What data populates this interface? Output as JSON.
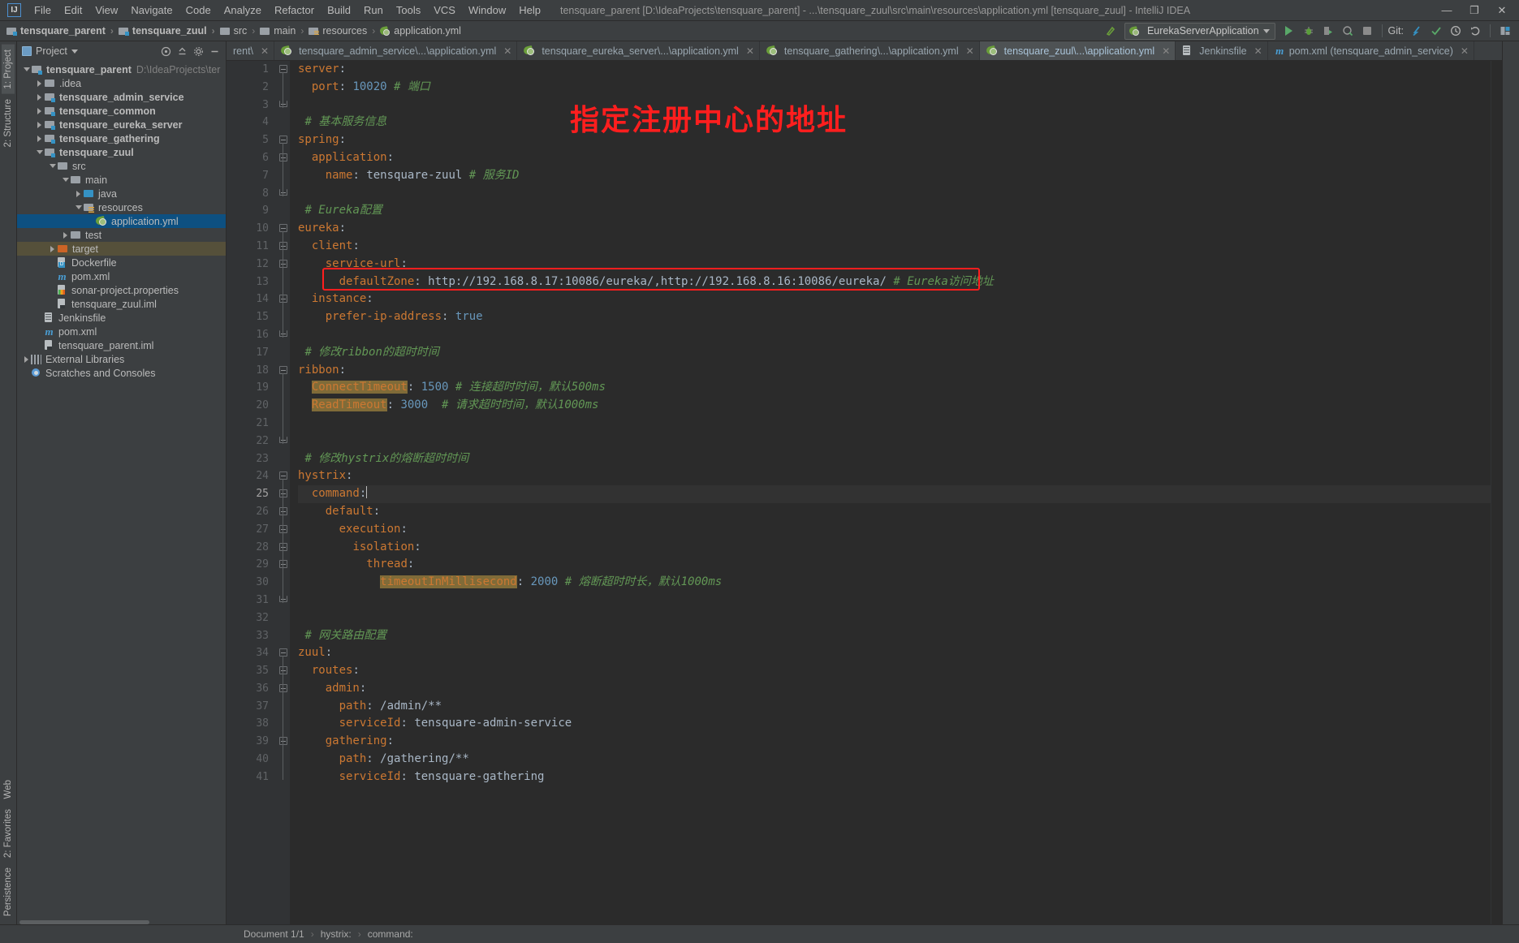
{
  "window": {
    "title": "tensquare_parent [D:\\IdeaProjects\\tensquare_parent] - ...\\tensquare_zuul\\src\\main\\resources\\application.yml [tensquare_zuul] - IntelliJ IDEA",
    "logo": "IJ",
    "minimize": "—",
    "maximize": "❐",
    "close": "✕"
  },
  "menu": [
    {
      "label": "File"
    },
    {
      "label": "Edit"
    },
    {
      "label": "View"
    },
    {
      "label": "Navigate"
    },
    {
      "label": "Code"
    },
    {
      "label": "Analyze"
    },
    {
      "label": "Refactor"
    },
    {
      "label": "Build"
    },
    {
      "label": "Run"
    },
    {
      "label": "Tools"
    },
    {
      "label": "VCS"
    },
    {
      "label": "Window"
    },
    {
      "label": "Help"
    }
  ],
  "breadcrumbs": [
    {
      "label": "tensquare_parent",
      "icon": "module-icon"
    },
    {
      "label": "tensquare_zuul",
      "icon": "module-icon"
    },
    {
      "label": "src",
      "icon": "folder-icon"
    },
    {
      "label": "main",
      "icon": "folder-icon"
    },
    {
      "label": "resources",
      "icon": "resources-folder-icon"
    },
    {
      "label": "application.yml",
      "icon": "yaml-file-icon"
    }
  ],
  "toolbar": {
    "run_configuration": "EurekaServerApplication",
    "git_label": "Git:",
    "icons": [
      "build-icon",
      "run-icon",
      "debug-icon",
      "run-coverage-icon",
      "profile-icon",
      "stop-icon",
      "update-project-icon",
      "commit-icon",
      "history-icon",
      "rollback-icon",
      "settings-icon"
    ]
  },
  "project_panel": {
    "title": "Project",
    "tools": [
      "collapse-all-icon",
      "scroll-from-source-icon",
      "settings-icon",
      "hide-icon"
    ],
    "tree": [
      {
        "depth": 0,
        "arrow": "down",
        "icon": "module-icon",
        "label": "tensquare_parent",
        "bold": true,
        "path": "D:\\IdeaProjects\\ter"
      },
      {
        "depth": 1,
        "arrow": "right",
        "icon": "folder-icon",
        "label": ".idea",
        "bold": false,
        "path": ""
      },
      {
        "depth": 1,
        "arrow": "right",
        "icon": "module-icon",
        "label": "tensquare_admin_service",
        "bold": true,
        "path": ""
      },
      {
        "depth": 1,
        "arrow": "right",
        "icon": "module-icon",
        "label": "tensquare_common",
        "bold": true,
        "path": ""
      },
      {
        "depth": 1,
        "arrow": "right",
        "icon": "module-icon",
        "label": "tensquare_eureka_server",
        "bold": true,
        "path": ""
      },
      {
        "depth": 1,
        "arrow": "right",
        "icon": "module-icon",
        "label": "tensquare_gathering",
        "bold": true,
        "path": ""
      },
      {
        "depth": 1,
        "arrow": "down",
        "icon": "module-icon",
        "label": "tensquare_zuul",
        "bold": true,
        "path": ""
      },
      {
        "depth": 2,
        "arrow": "down",
        "icon": "folder-icon",
        "label": "src",
        "bold": false,
        "path": ""
      },
      {
        "depth": 3,
        "arrow": "down",
        "icon": "folder-icon",
        "label": "main",
        "bold": false,
        "path": ""
      },
      {
        "depth": 4,
        "arrow": "right",
        "icon": "source-root-icon",
        "label": "java",
        "bold": false,
        "path": ""
      },
      {
        "depth": 4,
        "arrow": "down",
        "icon": "resources-folder-icon",
        "label": "resources",
        "bold": false,
        "path": ""
      },
      {
        "depth": 5,
        "arrow": "none",
        "icon": "yaml-file-icon",
        "label": "application.yml",
        "bold": false,
        "path": "",
        "selected": true
      },
      {
        "depth": 3,
        "arrow": "right",
        "icon": "folder-icon",
        "label": "test",
        "bold": false,
        "path": ""
      },
      {
        "depth": 2,
        "arrow": "right",
        "icon": "target-folder-icon",
        "label": "target",
        "bold": false,
        "path": "",
        "target": true
      },
      {
        "depth": 2,
        "arrow": "none",
        "icon": "dockerfile-icon",
        "label": "Dockerfile",
        "bold": false,
        "path": ""
      },
      {
        "depth": 2,
        "arrow": "none",
        "icon": "maven-pom-icon",
        "label": "pom.xml",
        "bold": false,
        "path": ""
      },
      {
        "depth": 2,
        "arrow": "none",
        "icon": "sonar-properties-icon",
        "label": "sonar-project.properties",
        "bold": false,
        "path": ""
      },
      {
        "depth": 2,
        "arrow": "none",
        "icon": "iml-file-icon",
        "label": "tensquare_zuul.iml",
        "bold": false,
        "path": ""
      },
      {
        "depth": 1,
        "arrow": "none",
        "icon": "jenkins-file-icon",
        "label": "Jenkinsfile",
        "bold": false,
        "path": ""
      },
      {
        "depth": 1,
        "arrow": "none",
        "icon": "maven-pom-icon",
        "label": "pom.xml",
        "bold": false,
        "path": ""
      },
      {
        "depth": 1,
        "arrow": "none",
        "icon": "iml-file-icon",
        "label": "tensquare_parent.iml",
        "bold": false,
        "path": ""
      },
      {
        "depth": 0,
        "arrow": "right",
        "icon": "library-icon",
        "label": "External Libraries",
        "bold": false,
        "path": ""
      },
      {
        "depth": 0,
        "arrow": "none",
        "icon": "scratches-icon",
        "label": "Scratches and Consoles",
        "bold": false,
        "path": ""
      }
    ]
  },
  "left_tool_strip": {
    "top": [
      "1: Project",
      "2: Structure"
    ],
    "bottom": [
      "Web",
      "2: Favorites",
      "Persistence"
    ]
  },
  "editor_tabs": [
    {
      "label": "rent\\",
      "icon": "file-icon",
      "active": false
    },
    {
      "label": "tensquare_admin_service\\...\\application.yml",
      "icon": "yaml-file-icon",
      "active": false
    },
    {
      "label": "tensquare_eureka_server\\...\\application.yml",
      "icon": "yaml-file-icon",
      "active": false
    },
    {
      "label": "tensquare_gathering\\...\\application.yml",
      "icon": "yaml-file-icon",
      "active": false
    },
    {
      "label": "tensquare_zuul\\...\\application.yml",
      "icon": "yaml-file-icon",
      "active": true
    },
    {
      "label": "Jenkinsfile",
      "icon": "jenkins-file-icon",
      "active": false
    },
    {
      "label": "pom.xml (tensquare_admin_service)",
      "icon": "maven-pom-icon",
      "active": false
    }
  ],
  "editor": {
    "current_line": 25,
    "total_lines": 41,
    "lines": [
      {
        "n": 1,
        "fold": "start",
        "html": "<span class=\"k\">server</span><span class=\"kk\">:</span>"
      },
      {
        "n": 2,
        "fold": "none",
        "html": "  <span class=\"k\">port</span><span class=\"kk\">:</span> <span class=\"num\">10020</span> <span class=\"cmt\"># 端口</span>"
      },
      {
        "n": 3,
        "fold": "end",
        "html": ""
      },
      {
        "n": 4,
        "fold": "none",
        "html": " <span class=\"cmt\"># 基本服务信息</span>"
      },
      {
        "n": 5,
        "fold": "start",
        "html": "<span class=\"k\">spring</span><span class=\"kk\">:</span>"
      },
      {
        "n": 6,
        "fold": "start",
        "html": "  <span class=\"k\">application</span><span class=\"kk\">:</span>"
      },
      {
        "n": 7,
        "fold": "none",
        "html": "    <span class=\"k\">name</span><span class=\"kk\">:</span> <span class=\"val\">tensquare-zuul</span> <span class=\"cmt\"># 服务ID</span>"
      },
      {
        "n": 8,
        "fold": "end",
        "html": ""
      },
      {
        "n": 9,
        "fold": "none",
        "html": " <span class=\"cmt\"># Eureka配置</span>"
      },
      {
        "n": 10,
        "fold": "start",
        "html": "<span class=\"k\">eureka</span><span class=\"kk\">:</span>"
      },
      {
        "n": 11,
        "fold": "start",
        "html": "  <span class=\"k\">client</span><span class=\"kk\">:</span>"
      },
      {
        "n": 12,
        "fold": "start",
        "html": "    <span class=\"k\">service-url</span><span class=\"kk\">:</span>"
      },
      {
        "n": 13,
        "fold": "none",
        "html": "      <span class=\"k\">defaultZone</span><span class=\"kk\">:</span> <span class=\"val\">http://192.168.8.17:10086/eureka/,http://192.168.8.16:10086/eureka/</span> <span class=\"cmt\"># Eureka访问地址</span>"
      },
      {
        "n": 14,
        "fold": "start",
        "html": "  <span class=\"k\">instance</span><span class=\"kk\">:</span>"
      },
      {
        "n": 15,
        "fold": "none",
        "html": "    <span class=\"k\">prefer-ip-address</span><span class=\"kk\">:</span> <span class=\"num\">true</span>"
      },
      {
        "n": 16,
        "fold": "end",
        "html": ""
      },
      {
        "n": 17,
        "fold": "none",
        "html": " <span class=\"cmt\"># 修改ribbon的超时时间</span>"
      },
      {
        "n": 18,
        "fold": "start",
        "html": "<span class=\"k\">ribbon</span><span class=\"kk\">:</span>"
      },
      {
        "n": 19,
        "fold": "none",
        "html": "  <span class=\"hl\">ConnectTimeout</span><span class=\"kk\">:</span> <span class=\"num\">1500</span> <span class=\"cmt\"># 连接超时时间，默认500ms</span>"
      },
      {
        "n": 20,
        "fold": "none",
        "html": "  <span class=\"hl\">ReadTimeout</span><span class=\"kk\">:</span> <span class=\"num\">3000</span>  <span class=\"cmt\"># 请求超时时间，默认1000ms</span>"
      },
      {
        "n": 21,
        "fold": "none",
        "html": ""
      },
      {
        "n": 22,
        "fold": "end",
        "html": ""
      },
      {
        "n": 23,
        "fold": "none",
        "html": " <span class=\"cmt\"># 修改hystrix的熔断超时时间</span>"
      },
      {
        "n": 24,
        "fold": "start",
        "html": "<span class=\"k\">hystrix</span><span class=\"kk\">:</span>"
      },
      {
        "n": 25,
        "fold": "start",
        "html": "  <span class=\"k\">command</span><span class=\"kk\">:</span><span class=\"caret\"></span>",
        "current": true
      },
      {
        "n": 26,
        "fold": "start",
        "html": "    <span class=\"k\">default</span><span class=\"kk\">:</span>"
      },
      {
        "n": 27,
        "fold": "start",
        "html": "      <span class=\"k\">execution</span><span class=\"kk\">:</span>"
      },
      {
        "n": 28,
        "fold": "start",
        "html": "        <span class=\"k\">isolation</span><span class=\"kk\">:</span>"
      },
      {
        "n": 29,
        "fold": "start",
        "html": "          <span class=\"k\">thread</span><span class=\"kk\">:</span>"
      },
      {
        "n": 30,
        "fold": "none",
        "html": "            <span class=\"hl\">timeoutInMillisecond</span><span class=\"kk\">:</span> <span class=\"num\">2000</span> <span class=\"cmt\"># 熔断超时时长，默认1000ms</span>"
      },
      {
        "n": 31,
        "fold": "end",
        "html": ""
      },
      {
        "n": 32,
        "fold": "none",
        "html": ""
      },
      {
        "n": 33,
        "fold": "none",
        "html": " <span class=\"cmt\"># 网关路由配置</span>"
      },
      {
        "n": 34,
        "fold": "start",
        "html": "<span class=\"k\">zuul</span><span class=\"kk\">:</span>"
      },
      {
        "n": 35,
        "fold": "start",
        "html": "  <span class=\"k\">routes</span><span class=\"kk\">:</span>"
      },
      {
        "n": 36,
        "fold": "start",
        "html": "    <span class=\"k\">admin</span><span class=\"kk\">:</span>"
      },
      {
        "n": 37,
        "fold": "none",
        "html": "      <span class=\"k\">path</span><span class=\"kk\">:</span> <span class=\"val\">/admin/**</span>"
      },
      {
        "n": 38,
        "fold": "none",
        "html": "      <span class=\"k\">serviceId</span><span class=\"kk\">:</span> <span class=\"val\">tensquare-admin-service</span>"
      },
      {
        "n": 39,
        "fold": "start",
        "html": "    <span class=\"k\">gathering</span><span class=\"kk\">:</span>"
      },
      {
        "n": 40,
        "fold": "none",
        "html": "      <span class=\"k\">path</span><span class=\"kk\">:</span> <span class=\"val\">/gathering/**</span>"
      },
      {
        "n": 41,
        "fold": "none",
        "html": "      <span class=\"k\">serviceId</span><span class=\"kk\">:</span> <span class=\"val\">tensquare-gathering</span>"
      }
    ]
  },
  "annotation": {
    "text": "指定注册中心的地址",
    "color": "#ff1e1e",
    "highlight_box_line": 13
  },
  "status_bar": {
    "document": "Document 1/1",
    "breadcrumb": [
      "hystrix:",
      "command:"
    ]
  }
}
